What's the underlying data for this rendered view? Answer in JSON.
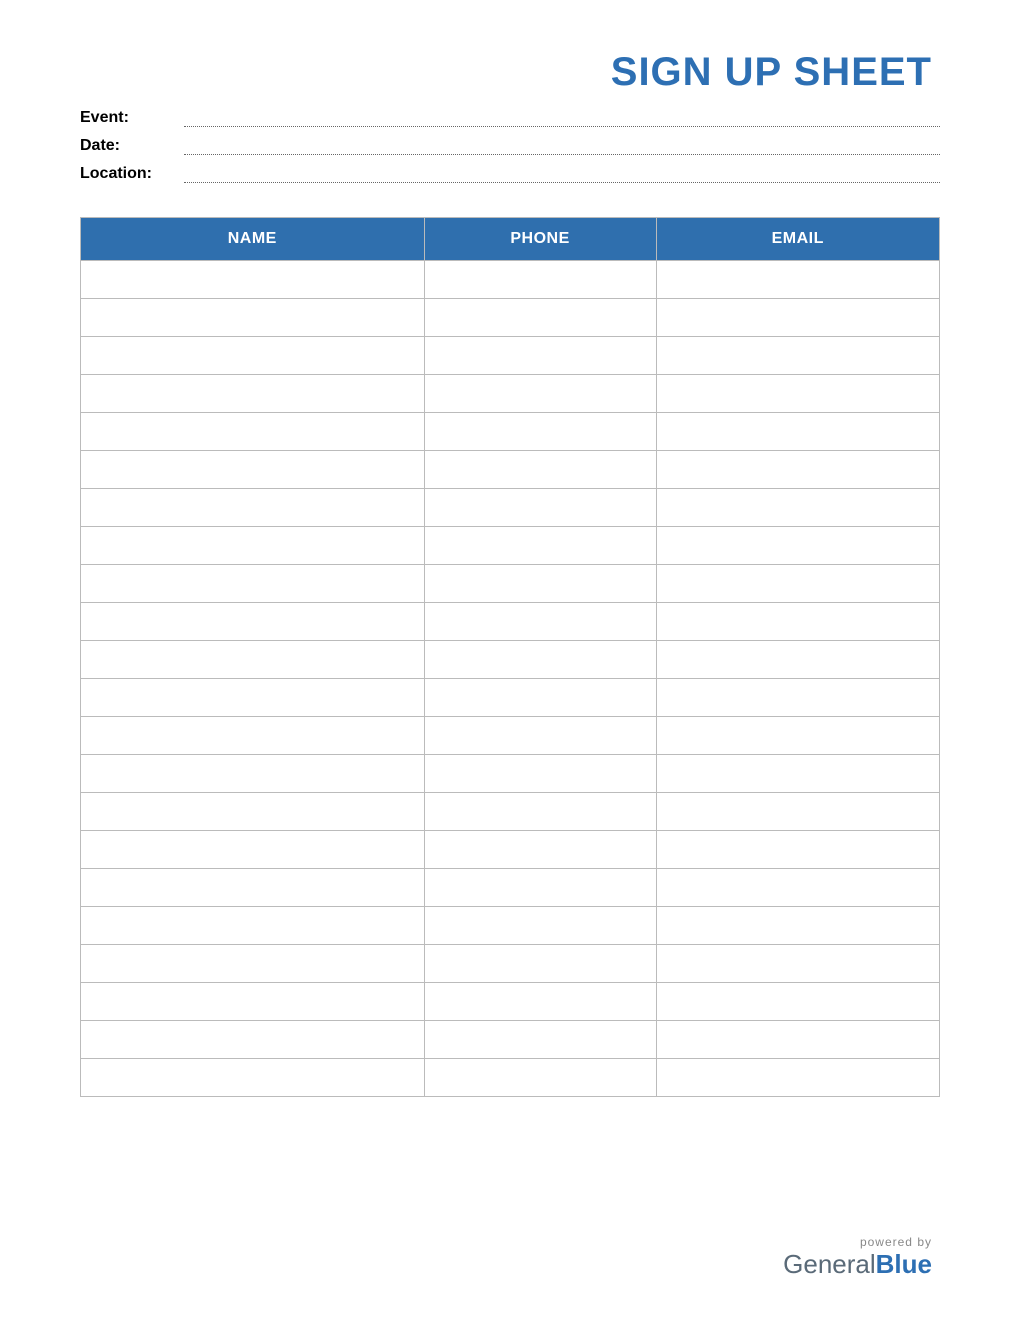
{
  "title": "SIGN UP SHEET",
  "meta": {
    "event_label": "Event:",
    "date_label": "Date:",
    "location_label": "Location:",
    "event_value": "",
    "date_value": "",
    "location_value": ""
  },
  "table": {
    "headers": {
      "name": "NAME",
      "phone": "PHONE",
      "email": "EMAIL"
    },
    "rows": [
      {
        "name": "",
        "phone": "",
        "email": ""
      },
      {
        "name": "",
        "phone": "",
        "email": ""
      },
      {
        "name": "",
        "phone": "",
        "email": ""
      },
      {
        "name": "",
        "phone": "",
        "email": ""
      },
      {
        "name": "",
        "phone": "",
        "email": ""
      },
      {
        "name": "",
        "phone": "",
        "email": ""
      },
      {
        "name": "",
        "phone": "",
        "email": ""
      },
      {
        "name": "",
        "phone": "",
        "email": ""
      },
      {
        "name": "",
        "phone": "",
        "email": ""
      },
      {
        "name": "",
        "phone": "",
        "email": ""
      },
      {
        "name": "",
        "phone": "",
        "email": ""
      },
      {
        "name": "",
        "phone": "",
        "email": ""
      },
      {
        "name": "",
        "phone": "",
        "email": ""
      },
      {
        "name": "",
        "phone": "",
        "email": ""
      },
      {
        "name": "",
        "phone": "",
        "email": ""
      },
      {
        "name": "",
        "phone": "",
        "email": ""
      },
      {
        "name": "",
        "phone": "",
        "email": ""
      },
      {
        "name": "",
        "phone": "",
        "email": ""
      },
      {
        "name": "",
        "phone": "",
        "email": ""
      },
      {
        "name": "",
        "phone": "",
        "email": ""
      },
      {
        "name": "",
        "phone": "",
        "email": ""
      },
      {
        "name": "",
        "phone": "",
        "email": ""
      }
    ]
  },
  "footer": {
    "powered_by": "powered by",
    "brand_a": "General",
    "brand_b": "Blue"
  }
}
